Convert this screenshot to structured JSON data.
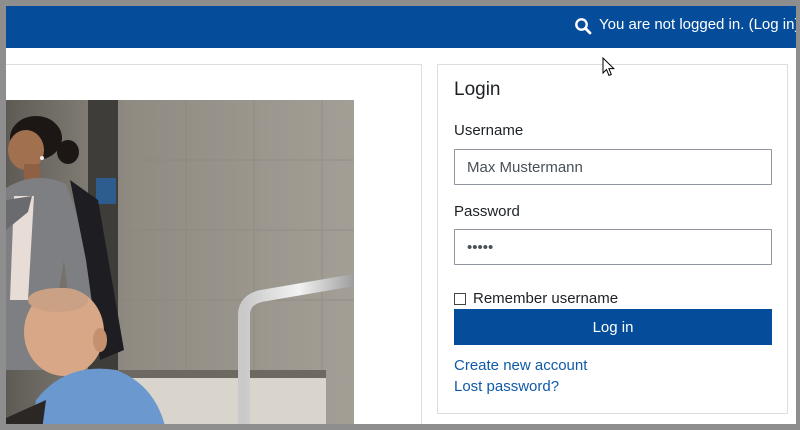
{
  "navbar": {
    "search_icon": "search-icon",
    "status_text": "You are not logged in. (",
    "login_link": "Log in",
    "status_close": ")"
  },
  "login": {
    "title": "Login",
    "username_label": "Username",
    "username_value": "Max Mustermann",
    "password_label": "Password",
    "password_value": "*****",
    "remember_label": "Remember username",
    "remember_checked": false,
    "submit_label": "Log in",
    "create_account": "Create new account",
    "lost_password": "Lost password?"
  },
  "colors": {
    "brand": "#054d9b",
    "link": "#0f5aa8"
  }
}
